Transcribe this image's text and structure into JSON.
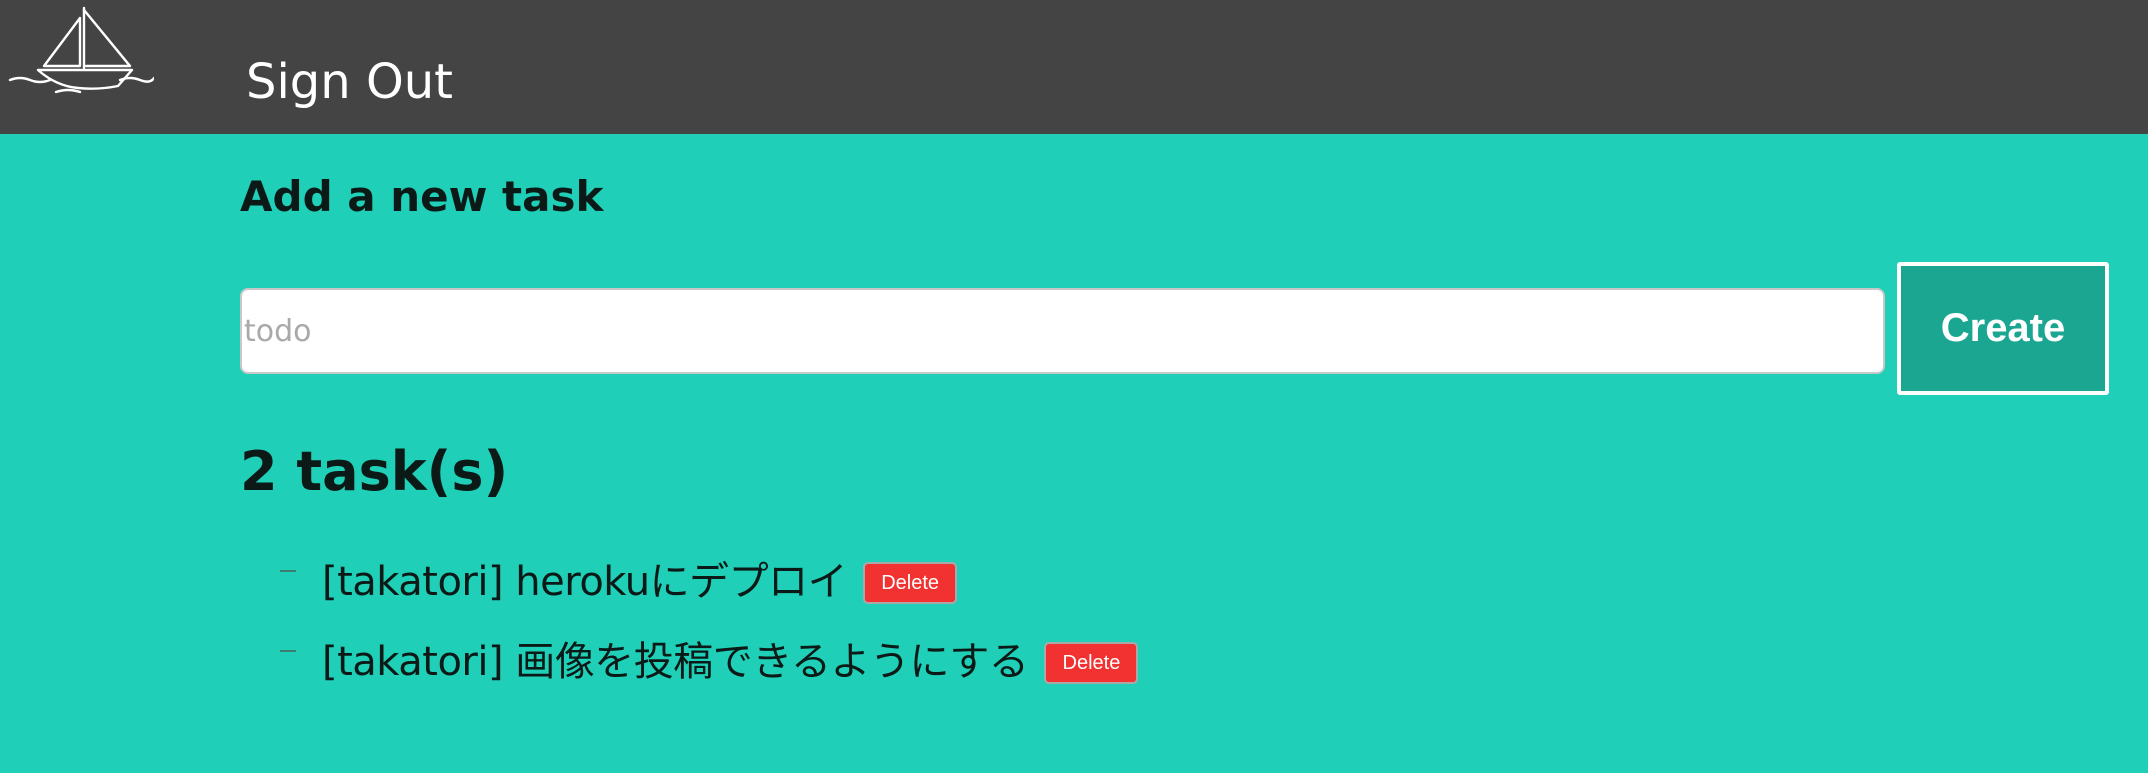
{
  "header": {
    "logo_icon": "sailboat-icon",
    "signout_label": "Sign Out",
    "background_color": "#444444"
  },
  "form": {
    "title": "Add a new task",
    "input_placeholder": "todo",
    "input_value": "",
    "create_label": "Create",
    "create_color": "#1aa690"
  },
  "tasks": {
    "count_label": "2 task(s)",
    "delete_color": "#f23131",
    "items": [
      {
        "text": "[takatori] herokuにデプロイ",
        "delete_label": "Delete"
      },
      {
        "text": "[takatori] 画像を投稿できるようにする",
        "delete_label": "Delete"
      }
    ]
  },
  "page": {
    "background_color": "#20cfb7"
  }
}
